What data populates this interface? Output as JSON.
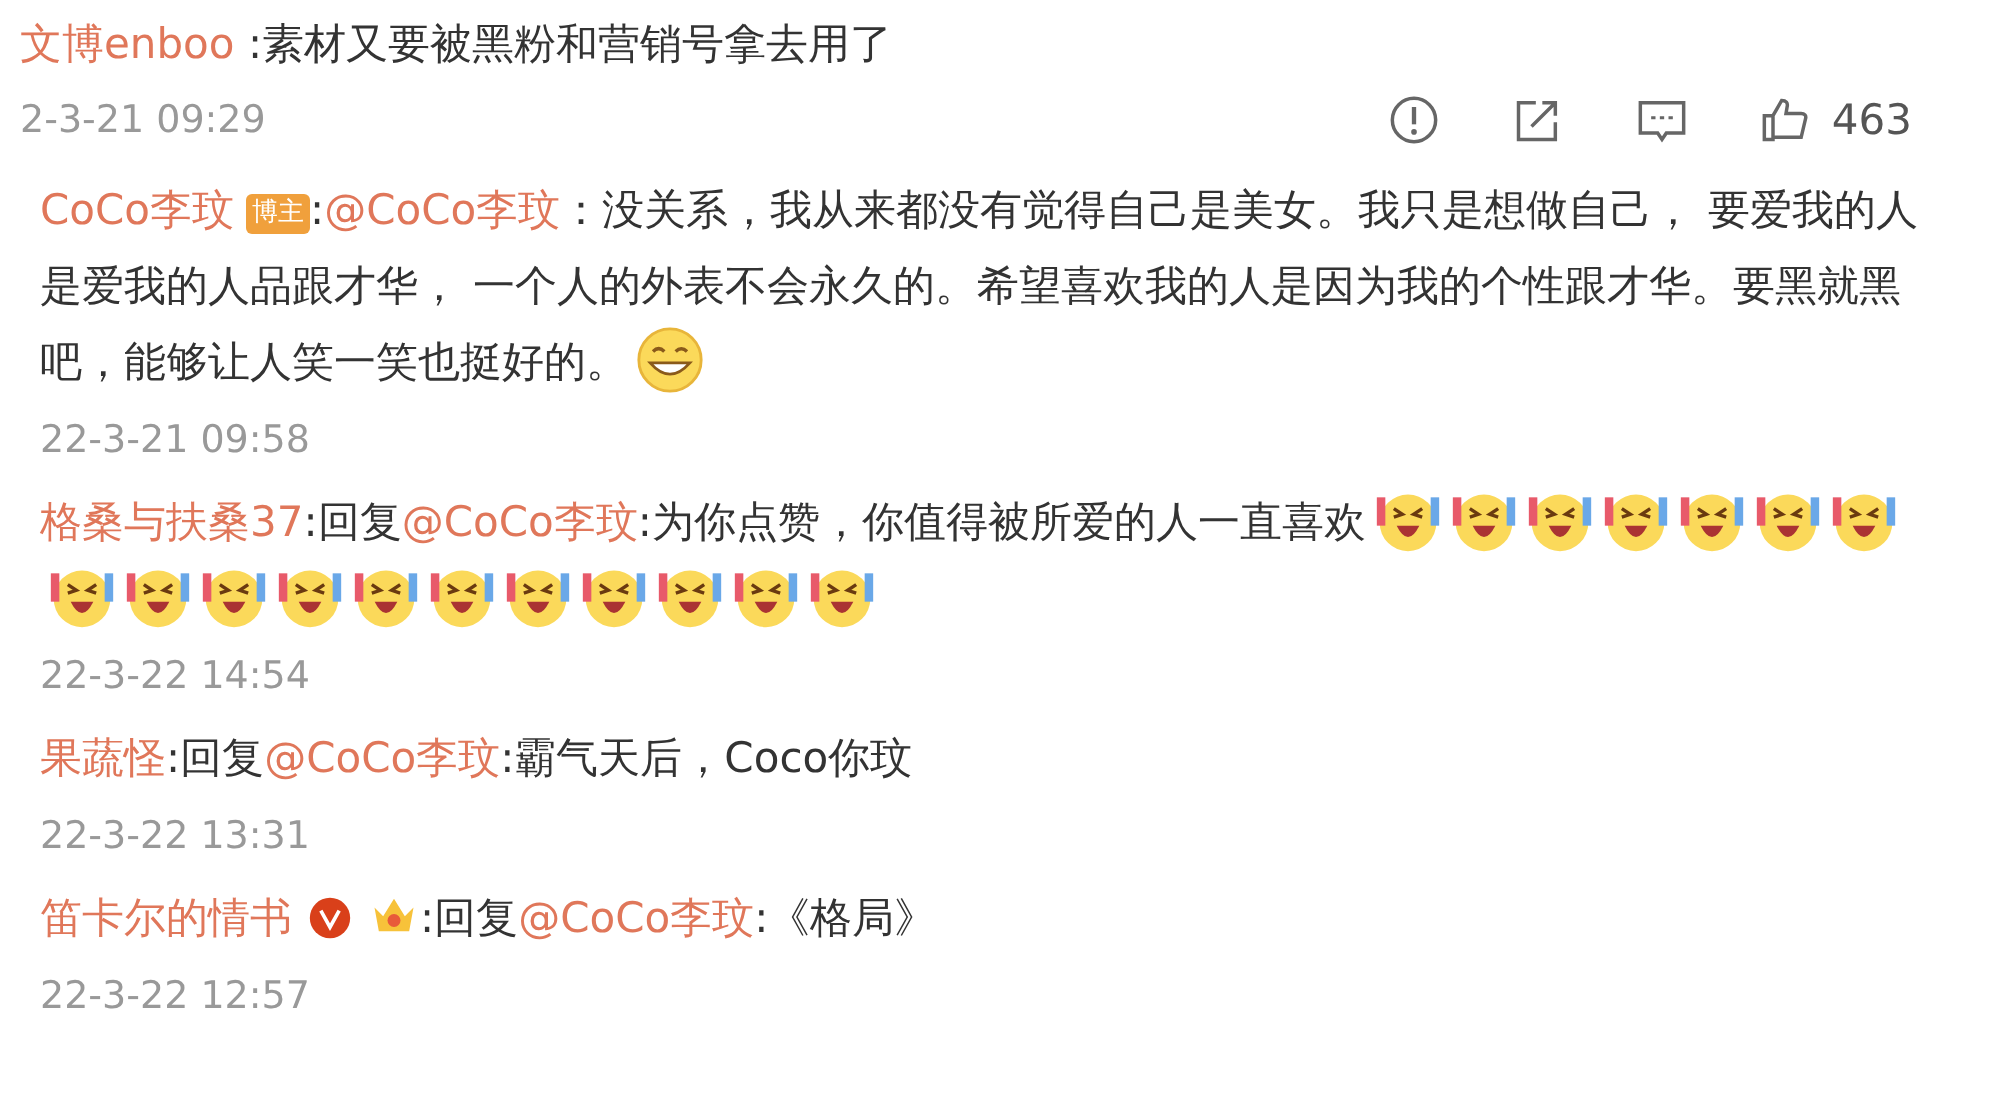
{
  "comment": {
    "author": "文博enboo",
    "text": " :素材又要被黑粉和营销号拿去用了",
    "time": "2-3-21 09:29",
    "actions": [
      {
        "kind": "report"
      },
      {
        "kind": "share"
      },
      {
        "kind": "comment"
      },
      {
        "kind": "like",
        "label": "463"
      }
    ]
  },
  "replies": [
    {
      "author": "CoCo李玟",
      "badge": "博主",
      "segments": [
        {
          "kind": "text",
          "text": ":"
        },
        {
          "kind": "mention",
          "text": "@CoCo李玟"
        },
        {
          "kind": "text",
          "text": "：没关系，我从来都没有觉得自己是美女。我只是想做自己， 要爱我的人是爱我的人品跟才华， 一个人的外表不会永久的。希望喜欢我的人是因为我的个性跟才华。要黑就黑吧，能够让人笑一笑也挺好的。"
        }
      ],
      "emojis": [
        {
          "kind": "grin"
        }
      ],
      "time": "22-3-21 09:58"
    },
    {
      "author": "格桑与扶桑37",
      "segments": [
        {
          "kind": "text",
          "text": ":回复"
        },
        {
          "kind": "mention",
          "text": "@CoCo李玟"
        },
        {
          "kind": "text",
          "text": ":为你点赞，你值得被所爱的人一直喜欢"
        }
      ],
      "emojis": [
        {
          "kind": "laugh-cry"
        },
        {
          "kind": "laugh-cry"
        },
        {
          "kind": "laugh-cry"
        },
        {
          "kind": "laugh-cry"
        },
        {
          "kind": "laugh-cry"
        },
        {
          "kind": "laugh-cry"
        },
        {
          "kind": "laugh-cry"
        },
        {
          "kind": "laugh-cry"
        },
        {
          "kind": "laugh-cry"
        },
        {
          "kind": "laugh-cry"
        },
        {
          "kind": "laugh-cry"
        },
        {
          "kind": "laugh-cry"
        },
        {
          "kind": "laugh-cry"
        },
        {
          "kind": "laugh-cry"
        },
        {
          "kind": "laugh-cry"
        },
        {
          "kind": "laugh-cry"
        },
        {
          "kind": "laugh-cry"
        },
        {
          "kind": "laugh-cry"
        }
      ],
      "time": "22-3-22 14:54"
    },
    {
      "author": "果蔬怪",
      "segments": [
        {
          "kind": "text",
          "text": ":回复"
        },
        {
          "kind": "mention",
          "text": "@CoCo李玟"
        },
        {
          "kind": "text",
          "text": ":霸气天后，Coco你玟"
        }
      ],
      "time": "22-3-22 13:31"
    },
    {
      "author": "笛卡尔的情书",
      "verified": true,
      "crown": true,
      "segments": [
        {
          "kind": "text",
          "text": ":回复"
        },
        {
          "kind": "mention",
          "text": "@CoCo李玟"
        },
        {
          "kind": "text",
          "text": ":《格局》"
        }
      ],
      "time": "22-3-22 12:57"
    }
  ]
}
